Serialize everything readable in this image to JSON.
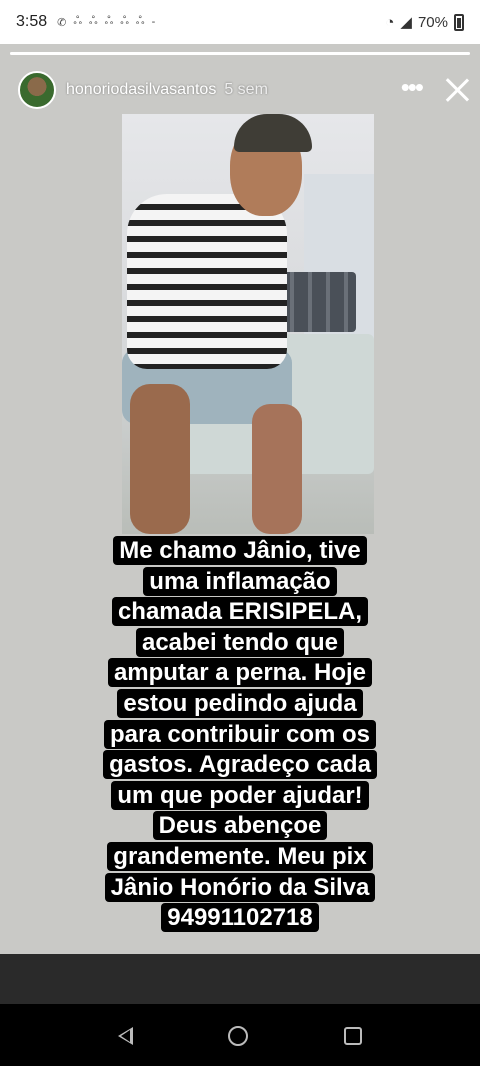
{
  "status_bar": {
    "time": "3:58",
    "notif_icons": [
      "whatsapp-icon",
      "notif-icon",
      "notif-icon",
      "notif-icon",
      "notif-icon",
      "notif-icon"
    ],
    "overflow": "-",
    "battery_percent": "70%"
  },
  "story": {
    "username": "honoriodasilvasantos",
    "time_ago": "5 sem",
    "progress": 1.0,
    "caption_lines": [
      "Me chamo Jânio, tive",
      "uma inflamação",
      "chamada ERISIPELA,",
      "acabei tendo que",
      "amputar a perna. Hoje",
      "estou pedindo ajuda",
      "para contribuir com os",
      "gastos.  Agradeço cada",
      "um que poder ajudar!",
      "Deus abençoe",
      "grandemente.  Meu pix",
      "Jânio Honório da Silva",
      "94991102718"
    ]
  },
  "colors": {
    "story_background": "#c9c9c6",
    "caption_text": "#ffffff",
    "caption_background": "#000000"
  }
}
